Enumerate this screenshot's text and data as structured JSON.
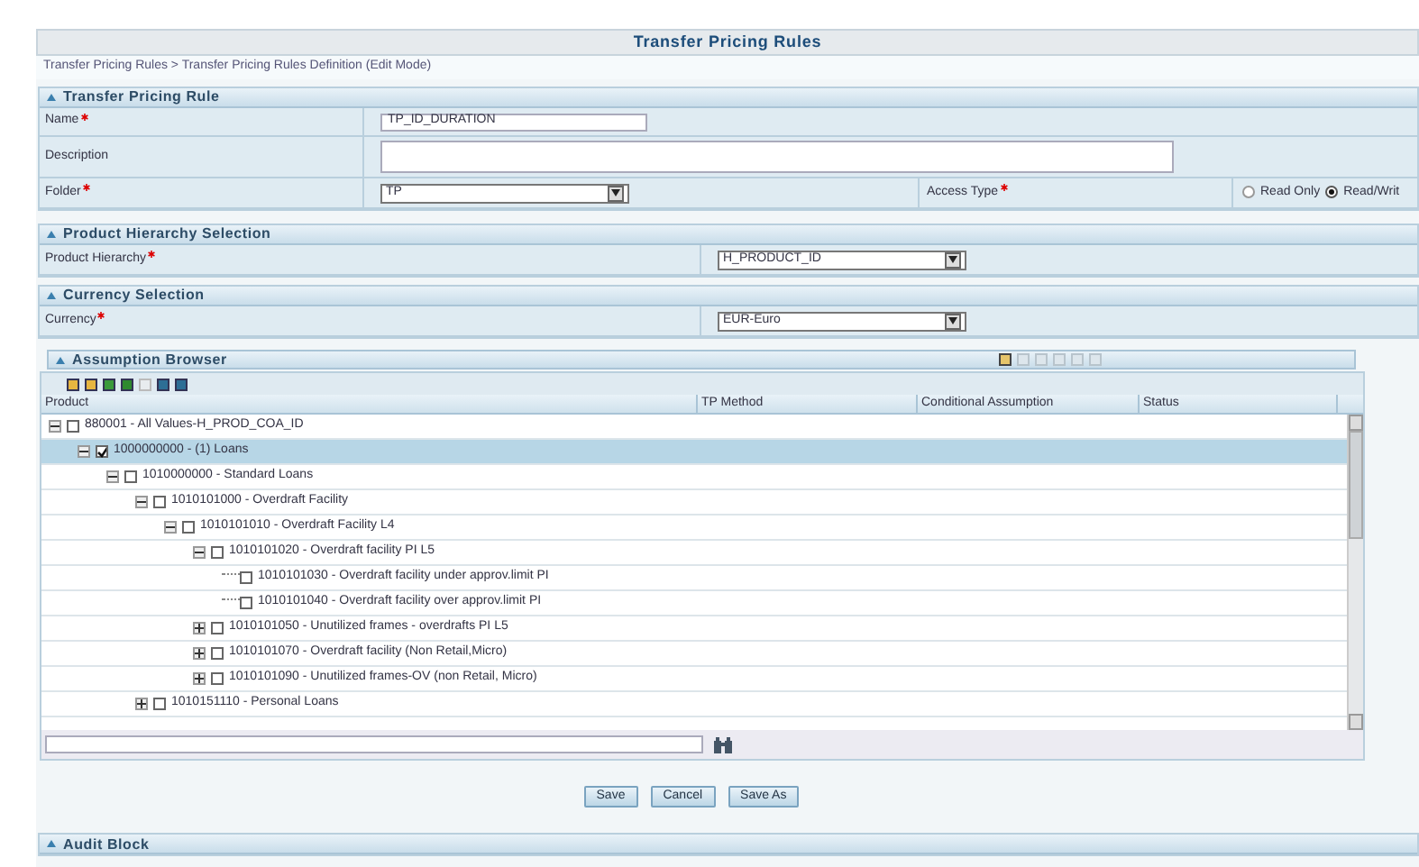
{
  "page_title": "Transfer Pricing Rules",
  "breadcrumb": "Transfer Pricing Rules > Transfer Pricing Rules Definition (Edit Mode)",
  "rule_section": {
    "title": "Transfer Pricing Rule",
    "name_label": "Name",
    "name_value": "TP_ID_DURATION",
    "description_label": "Description",
    "folder_label": "Folder",
    "folder_value": "TP",
    "access_label": "Access Type",
    "access_options": [
      {
        "label": "Read Only",
        "selected": false
      },
      {
        "label": "Read/Writ",
        "selected": true
      }
    ]
  },
  "hierarchy_section": {
    "title": "Product Hierarchy Selection",
    "label": "Product Hierarchy",
    "value": "H_PRODUCT_ID"
  },
  "currency_section": {
    "title": "Currency Selection",
    "label": "Currency",
    "value": "EUR-Euro"
  },
  "assumption_browser": {
    "title": "Assumption Browser",
    "header_tools": [
      {
        "disabled": false
      },
      {
        "disabled": true
      },
      {
        "disabled": true
      },
      {
        "disabled": true
      },
      {
        "disabled": true
      },
      {
        "disabled": true
      }
    ],
    "tree_tools": [
      {
        "disabled": false
      },
      {
        "disabled": false
      },
      {
        "disabled": false
      },
      {
        "disabled": false
      },
      {
        "disabled": true
      },
      {
        "disabled": false
      },
      {
        "disabled": false
      }
    ],
    "columns": [
      "Product",
      "TP Method",
      "Conditional Assumption",
      "Status"
    ],
    "tree": [
      {
        "label": "880001 - All Values-H_PROD_COA_ID",
        "checked": false,
        "expanded": true,
        "selected": false,
        "children": [
          {
            "label": "1000000000 - (1) Loans",
            "checked": true,
            "expanded": true,
            "selected": true,
            "children": [
              {
                "label": "1010000000 - Standard Loans",
                "checked": false,
                "expanded": true,
                "selected": false,
                "children": [
                  {
                    "label": "1010101000 - Overdraft Facility",
                    "checked": false,
                    "expanded": true,
                    "selected": false,
                    "children": [
                      {
                        "label": "1010101010 - Overdraft Facility L4",
                        "checked": false,
                        "expanded": true,
                        "selected": false,
                        "children": [
                          {
                            "label": "1010101020 - Overdraft facility PI L5",
                            "checked": false,
                            "expanded": true,
                            "selected": false,
                            "children": [
                              {
                                "label": "1010101030 - Overdraft facility under approv.limit PI",
                                "checked": false,
                                "selected": false
                              },
                              {
                                "label": "1010101040 - Overdraft facility over approv.limit PI",
                                "checked": false,
                                "selected": false
                              }
                            ]
                          },
                          {
                            "label": "1010101050 - Unutilized frames - overdrafts PI L5",
                            "checked": false,
                            "expanded": false,
                            "selected": false
                          },
                          {
                            "label": "1010101070 - Overdraft facility (Non Retail,Micro)",
                            "checked": false,
                            "expanded": false,
                            "selected": false
                          },
                          {
                            "label": "1010101090 - Unutilized frames-OV (non Retail, Micro)",
                            "checked": false,
                            "expanded": false,
                            "selected": false
                          }
                        ]
                      }
                    ]
                  },
                  {
                    "label": "1010151110 - Personal Loans",
                    "checked": false,
                    "expanded": false,
                    "selected": false
                  }
                ]
              }
            ]
          }
        ]
      }
    ]
  },
  "buttons": [
    "Save",
    "Cancel",
    "Save As"
  ],
  "audit_section": {
    "title": "Audit Block"
  }
}
